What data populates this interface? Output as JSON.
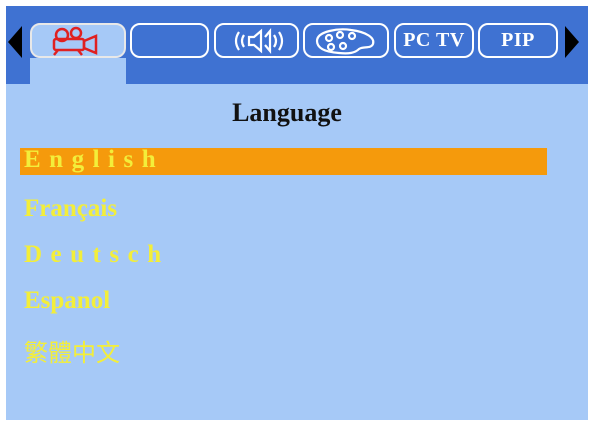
{
  "menu": {
    "tabs": [
      {
        "id": "picture",
        "icon": "projector-icon",
        "label": ""
      },
      {
        "id": "blank",
        "icon": "",
        "label": ""
      },
      {
        "id": "sound",
        "icon": "speaker-icon",
        "label": ""
      },
      {
        "id": "color",
        "icon": "palette-icon",
        "label": ""
      },
      {
        "id": "pc-tv",
        "icon": "",
        "label": "PC TV"
      },
      {
        "id": "pip",
        "icon": "",
        "label": "PIP"
      }
    ],
    "active_tab": "picture"
  },
  "page": {
    "title": "Language"
  },
  "languages": {
    "items": [
      "English",
      "Français",
      "Deutsch",
      "Espanol",
      "繁體中文"
    ],
    "selected": "English"
  },
  "colors": {
    "background": "#a6c9f7",
    "topbar": "#3f72d2",
    "highlight": "#f59a0c",
    "item_text": "#f3ee3a",
    "active_icon": "#e02020"
  }
}
